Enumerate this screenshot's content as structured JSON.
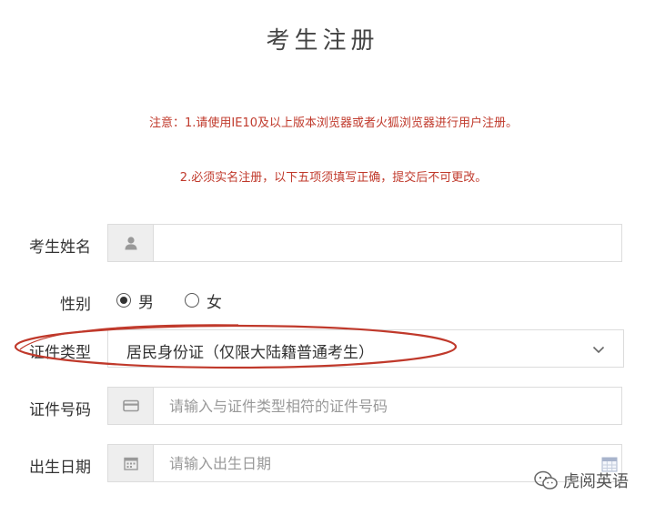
{
  "page": {
    "title": "考生注册"
  },
  "notices": {
    "line1": "注意：1.请使用IE10及以上版本浏览器或者火狐浏览器进行用户注册。",
    "line2": "2.必须实名注册，以下五项须填写正确，提交后不可更改。"
  },
  "form": {
    "name": {
      "label": "考生姓名",
      "value": "",
      "icon": "user-icon"
    },
    "gender": {
      "label": "性别",
      "options": [
        "男",
        "女"
      ],
      "selected": "男"
    },
    "id_type": {
      "label": "证件类型",
      "value": "居民身份证（仅限大陆籍普通考生）",
      "icon": "chevron-down-icon"
    },
    "id_number": {
      "label": "证件号码",
      "placeholder": "请输入与证件类型相符的证件号码",
      "icon": "id-card-icon"
    },
    "birth_date": {
      "label": "出生日期",
      "placeholder": "请输入出生日期",
      "icon": "calendar-icon"
    }
  },
  "annotation": {
    "color": "#c0392b"
  },
  "watermark": {
    "text": "虎阅英语",
    "icon": "wechat-icon"
  }
}
